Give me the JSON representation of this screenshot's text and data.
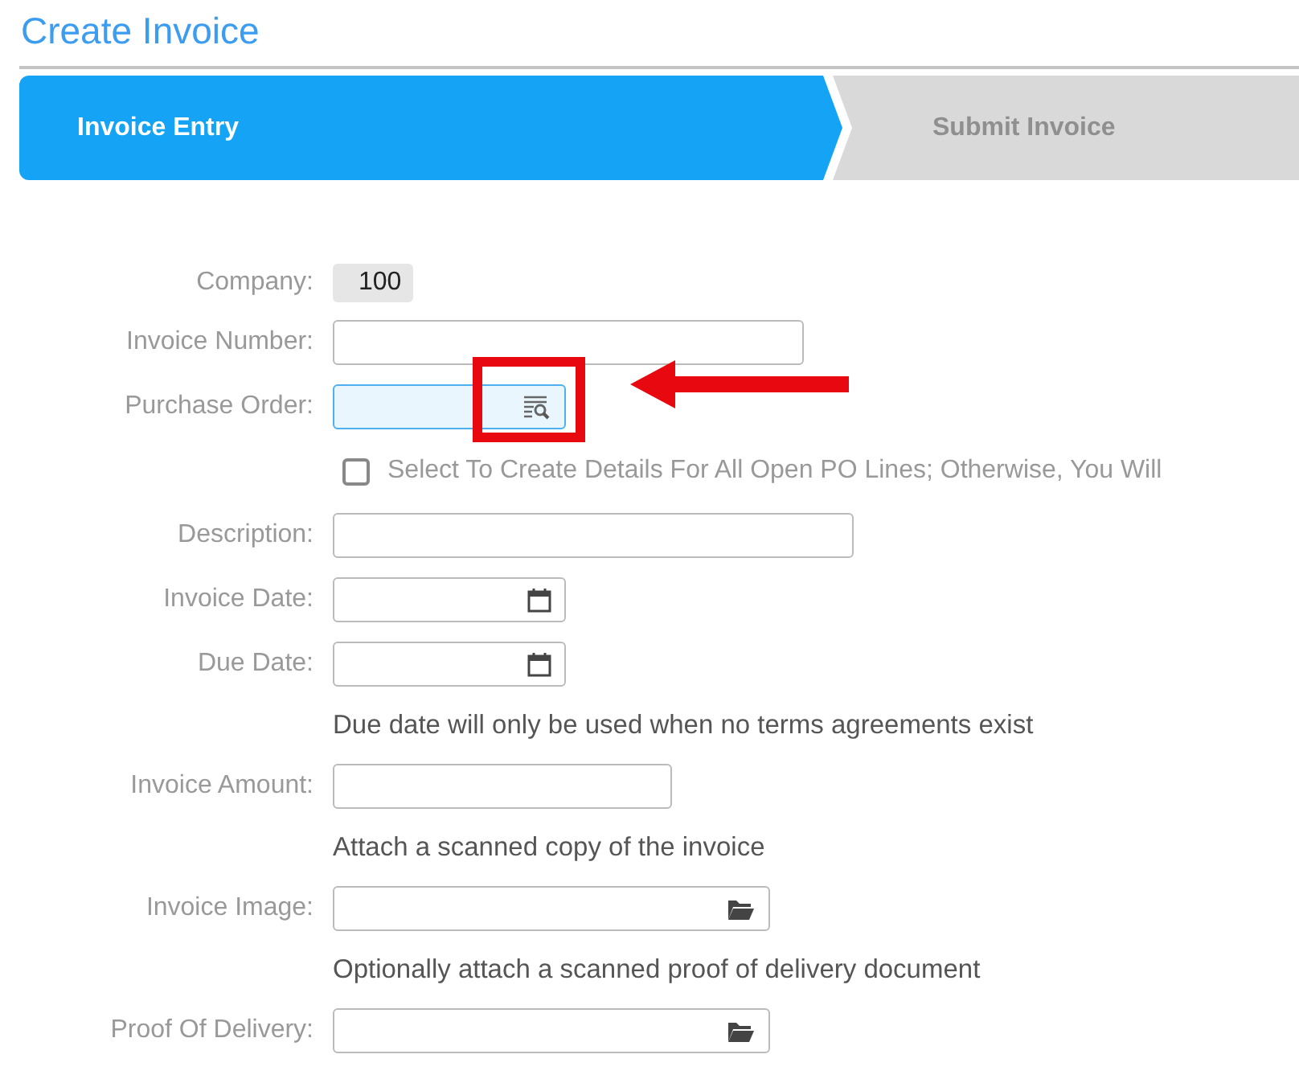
{
  "title": "Create Invoice",
  "steps": [
    {
      "label": "Invoice Entry",
      "selected": true
    },
    {
      "label": "Submit Invoice",
      "selected": false
    }
  ],
  "rows": [
    {
      "kind": "static",
      "label": "Company:",
      "value": "100"
    },
    {
      "kind": "text",
      "label": "Invoice Number:"
    },
    {
      "kind": "lookup",
      "label": "Purchase Order:",
      "focused": true
    },
    {
      "kind": "checkbox",
      "text": "Select To Create Details For All Open PO Lines; Otherwise, You Will",
      "checked": false
    },
    {
      "kind": "text",
      "label": "Description:"
    },
    {
      "kind": "date",
      "label": "Invoice Date:"
    },
    {
      "kind": "date",
      "label": "Due Date:"
    },
    {
      "kind": "note",
      "text": "Due date will only be used when no terms agreements exist"
    },
    {
      "kind": "text",
      "label": "Invoice Amount:"
    },
    {
      "kind": "note",
      "text": "Attach a scanned copy of the invoice"
    },
    {
      "kind": "file",
      "label": "Invoice Image:"
    },
    {
      "kind": "note",
      "text": "Optionally attach a scanned proof of delivery document"
    },
    {
      "kind": "file",
      "label": "Proof Of Delivery:"
    }
  ]
}
